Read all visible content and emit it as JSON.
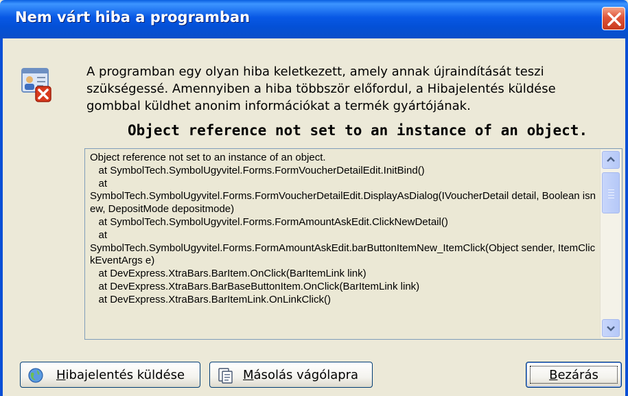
{
  "window": {
    "title": "Nem várt hiba a programban"
  },
  "message": "A programban egy olyan hiba keletkezett, amely annak újraindítását teszi szükségessé. Amennyiben a hiba többször előfordul, a Hibajelentés küldése gombbal küldhet anonim információkat a termék gyártójának.",
  "error_title": "Object reference not set to an instance of an object.",
  "details_text": "Object reference not set to an instance of an object.\n   at SymbolTech.SymbolUgyvitel.Forms.FormVoucherDetailEdit.InitBind()\n   at\nSymbolTech.SymbolUgyvitel.Forms.FormVoucherDetailEdit.DisplayAsDialog(IVoucherDetail detail, Boolean isnew, DepositMode depositmode)\n   at SymbolTech.SymbolUgyvitel.Forms.FormAmountAskEdit.ClickNewDetail()\n   at\nSymbolTech.SymbolUgyvitel.Forms.FormAmountAskEdit.barButtonItemNew_ItemClick(Object sender, ItemClickEventArgs e)\n   at DevExpress.XtraBars.BarItem.OnClick(BarItemLink link)\n   at DevExpress.XtraBars.BarBaseButtonItem.OnClick(BarItemLink link)\n   at DevExpress.XtraBars.BarItemLink.OnLinkClick()",
  "buttons": {
    "send_first": "H",
    "send_rest": "ibajelentés küldése",
    "copy_first": "M",
    "copy_rest": "ásolás vágólapra",
    "close_first": "B",
    "close_rest": "ezárás"
  },
  "icons": {
    "app": "contact-card-error-icon",
    "send": "globe-send-icon",
    "copy": "clipboard-copy-icon",
    "close": "close-icon"
  },
  "colors": {
    "titlebar": "#0450d6",
    "close_button": "#e0553a",
    "dialog_bg": "#ece9d8"
  }
}
